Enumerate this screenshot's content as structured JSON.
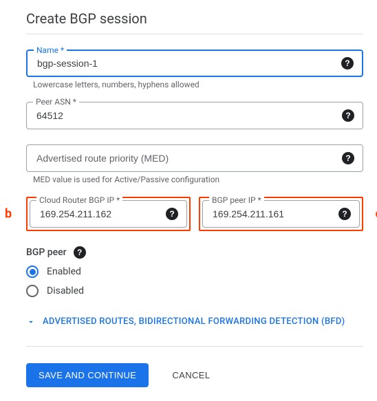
{
  "title": "Create BGP session",
  "fields": {
    "name": {
      "label": "Name *",
      "value": "bgp-session-1",
      "help": "Lowercase letters, numbers, hyphens allowed"
    },
    "peer_asn": {
      "label": "Peer ASN *",
      "value": "64512"
    },
    "med": {
      "placeholder": "Advertised route priority (MED)",
      "help": "MED value is used for Active/Passive configuration"
    },
    "cloud_router_ip": {
      "label": "Cloud Router BGP IP *",
      "value": "169.254.211.162"
    },
    "bgp_peer_ip": {
      "label": "BGP peer IP *",
      "value": "169.254.211.161"
    }
  },
  "bgp_peer": {
    "label": "BGP peer",
    "options": {
      "enabled": "Enabled",
      "disabled": "Disabled"
    }
  },
  "expander": {
    "label": "ADVERTISED ROUTES, BIDIRECTIONAL FORWARDING DETECTION (BFD)"
  },
  "buttons": {
    "save": "SAVE AND CONTINUE",
    "cancel": "CANCEL"
  },
  "annotations": {
    "b": "b",
    "c": "c"
  },
  "icons": {
    "help": "?"
  }
}
